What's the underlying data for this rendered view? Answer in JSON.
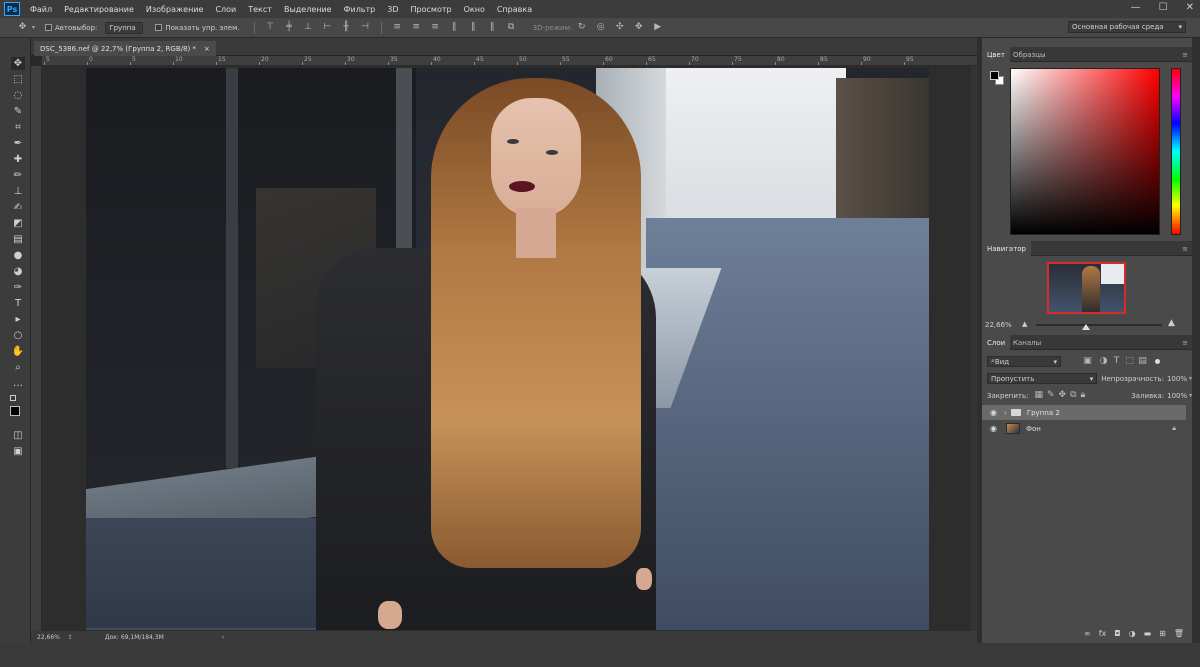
{
  "app": {
    "logo": "Ps"
  },
  "menu": [
    "Файл",
    "Редактирование",
    "Изображение",
    "Слои",
    "Текст",
    "Выделение",
    "Фильтр",
    "3D",
    "Просмотр",
    "Окно",
    "Справка"
  ],
  "window_controls": {
    "minimize": "—",
    "maximize": "☐",
    "close": "✕"
  },
  "options": {
    "autoselect_label": "Автовыбор:",
    "autoselect_value": "Группа",
    "show_controls_label": "Показать упр. элем.",
    "mode3d_label": "3D-режим:",
    "workspace": "Основная рабочая среда"
  },
  "document": {
    "tab_title": "DSC_5386.nef @ 22,7% (Группа 2, RGB/8) *",
    "tab_close": "×",
    "ruler_top": [
      "5",
      "0",
      "5",
      "10",
      "15",
      "20",
      "25",
      "30",
      "35",
      "40",
      "45",
      "50",
      "55",
      "60",
      "65",
      "70",
      "75",
      "80",
      "85",
      "90",
      "95"
    ],
    "status_zoom": "22,66%",
    "status_doc": "Док: 69,1M/184,3M"
  },
  "color_panel": {
    "tabs": [
      "Цвет",
      "Образцы"
    ]
  },
  "navigator": {
    "tab": "Навигатор",
    "zoom": "22,66%"
  },
  "layers_panel": {
    "tabs": [
      "Слои",
      "Каналы"
    ],
    "filter_kind": "Вид",
    "blend_mode": "Пропустить",
    "opacity_label": "Непрозрачность:",
    "opacity_value": "100%",
    "lock_label": "Закрепить:",
    "fill_label": "Заливка:",
    "fill_value": "100%",
    "layers": [
      {
        "name": "Группа 2",
        "type": "group",
        "selected": true
      },
      {
        "name": "Фон",
        "type": "image",
        "selected": false,
        "locked": true
      }
    ]
  }
}
